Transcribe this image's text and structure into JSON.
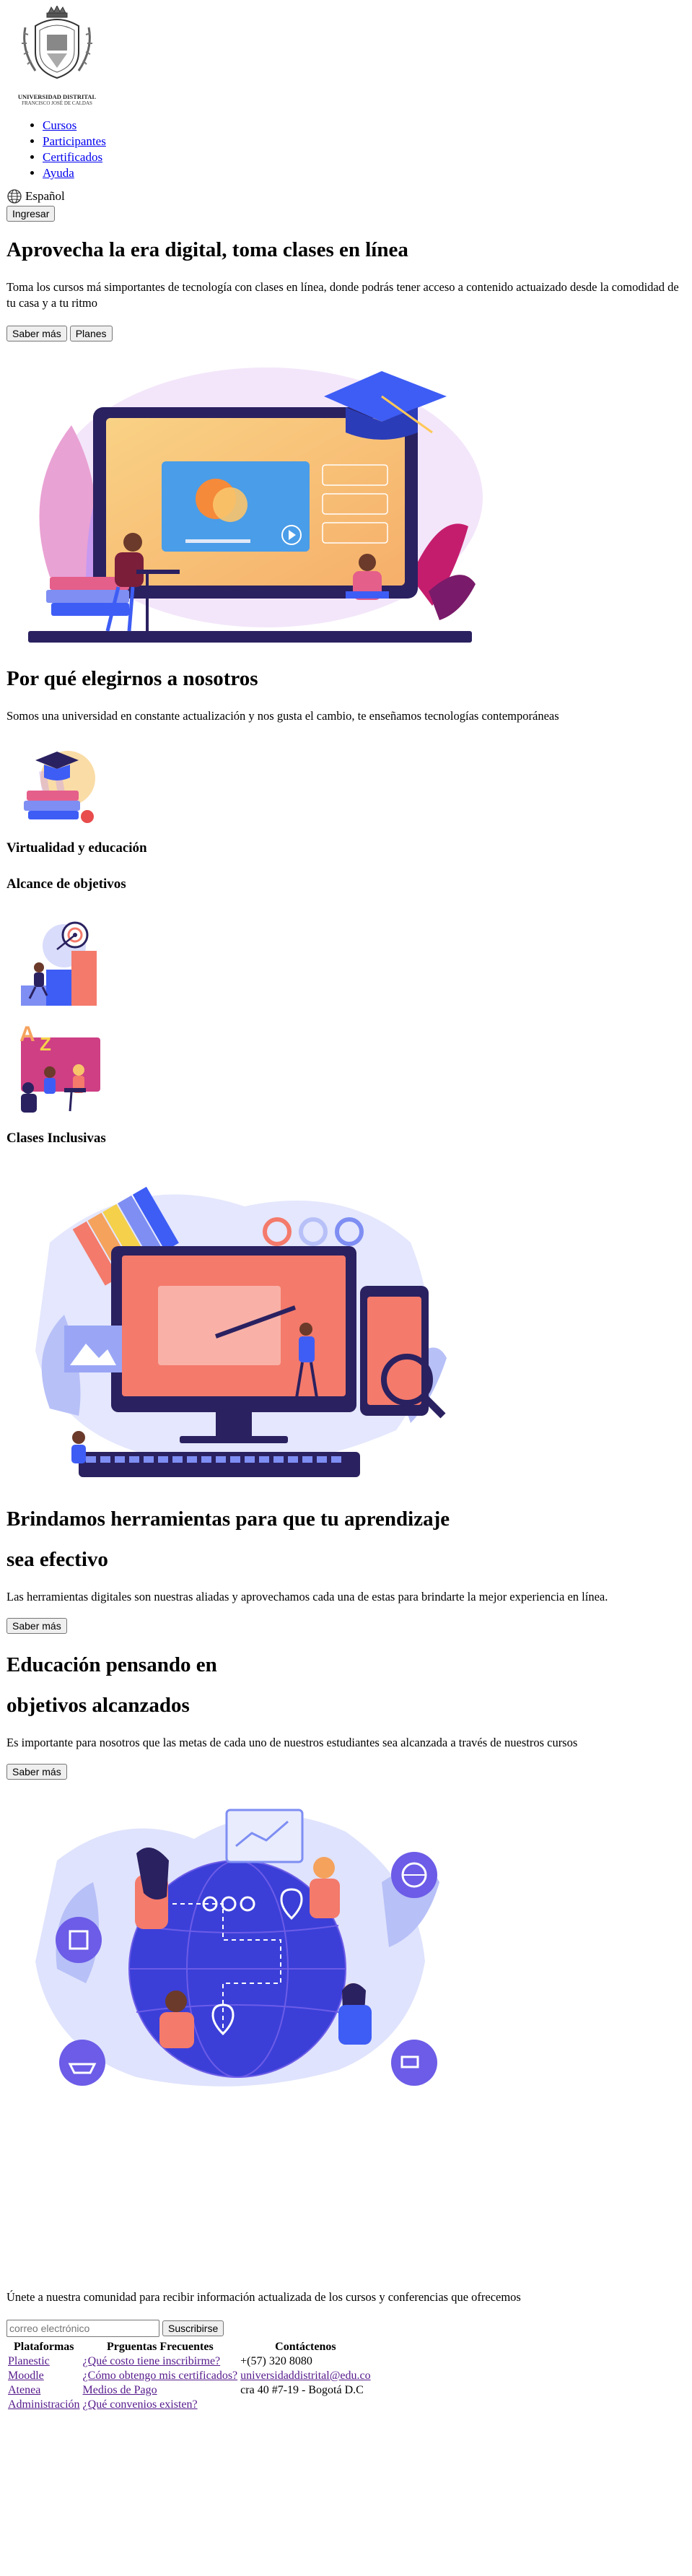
{
  "header": {
    "logo_title": "UNIVERSIDAD DISTRITAL",
    "logo_subtitle": "FRANCISCO JOSÉ DE CALDAS",
    "nav": [
      {
        "label": "Cursos"
      },
      {
        "label": "Participantes"
      },
      {
        "label": "Certificados"
      },
      {
        "label": "Ayuda"
      }
    ],
    "language": "Español",
    "login_label": "Ingresar"
  },
  "hero": {
    "title": "Aprovecha la era digital, toma clases en línea",
    "text": "Toma los cursos má simportantes de tecnología con clases en línea, donde podrás tener acceso a contenido actuaizado desde la comodidad de tu casa y a tu ritmo",
    "more_label": "Saber más",
    "plans_label": "Planes"
  },
  "why": {
    "title": "Por qué elegirnos a nosotros",
    "text": "Somos una universidad en constante actualización y nos gusta el cambio, te enseñamos tecnologías contemporáneas",
    "item1": "Virtualidad y educación",
    "item2": "Alcance de objetivos",
    "item3": "Clases Inclusivas"
  },
  "tools": {
    "title_line1": "Brindamos herramientas para que tu aprendizaje",
    "title_line2": "sea efectivo",
    "text": "Las herramientas digitales son nuestras aliadas y aprovechamos cada una de estas para brindarte la mejor experiencia en línea.",
    "more_label": "Saber más"
  },
  "goals": {
    "title_line1": "Educación pensando en",
    "title_line2": "objetivos alcanzados",
    "text": "Es importante para nosotros que las metas de cada uno de nuestros estudiantes sea alcanzada a través de nuestros cursos",
    "more_label": "Saber más"
  },
  "footer": {
    "community_text": "Únete a nuestra comunidad para recibir información actualizada de los cursos y conferencias que ofrecemos",
    "email_placeholder": "correo electrónico",
    "subscribe_label": "Suscribirse",
    "columns": [
      "Plataformas",
      "Prguentas Frecuentes",
      "Contáctenos"
    ],
    "rows": [
      [
        "Planestic",
        "¿Qué costo tiene inscribirme?",
        "+(57) 320 8080"
      ],
      [
        "Moodle",
        "¿Cómo obtengo mis certificados?",
        "universidaddistrital@edu.co"
      ],
      [
        "Atenea",
        "Medios de Pago",
        "cra 40 #7-19 - Bogotá D.C"
      ],
      [
        "Administración",
        "¿Qué convenios existen?",
        ""
      ]
    ]
  },
  "colors": {
    "link": "#0000ee",
    "visited": "#551a8b",
    "indigo": "#3b3fd8",
    "violet": "#6c5ce7",
    "coral": "#f47a6b",
    "orange": "#f5a25d",
    "lavender": "#d9dcfb"
  }
}
